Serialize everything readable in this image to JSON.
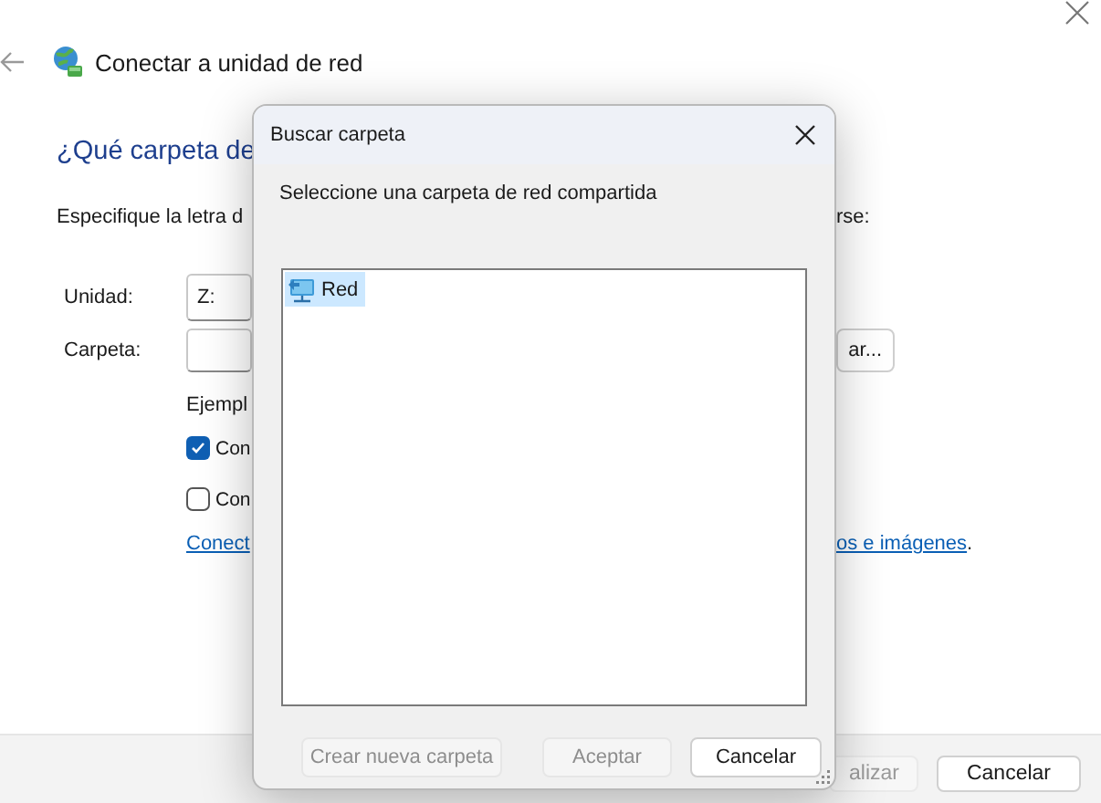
{
  "wizard": {
    "title": "Conectar a unidad de red",
    "heading": "¿Qué carpeta de",
    "instruction_start": "Especifique la letra d",
    "instruction_end": "rse:",
    "fields": [
      {
        "label": "Unidad:",
        "value": "Z:"
      },
      {
        "label": "Carpeta:"
      }
    ],
    "browse_button": "ar...",
    "example": "Ejempl",
    "options": [
      {
        "label": "Con",
        "checked": true
      },
      {
        "label": "Con",
        "checked": false
      }
    ],
    "link_start": "Conect",
    "link_end": "os e imágenes",
    "link_tail": ".",
    "footer_buttons": [
      {
        "label": "alizar",
        "disabled": true
      },
      {
        "label": "Cancelar",
        "disabled": false
      }
    ]
  },
  "dialog": {
    "title": "Buscar carpeta",
    "prompt": "Seleccione una carpeta de red compartida",
    "tree": [
      {
        "label": "Red",
        "selected": true
      }
    ],
    "buttons": [
      {
        "label": "Crear nueva carpeta",
        "disabled": true
      },
      {
        "label": "Aceptar",
        "disabled": true
      },
      {
        "label": "Cancelar",
        "disabled": false
      }
    ]
  }
}
